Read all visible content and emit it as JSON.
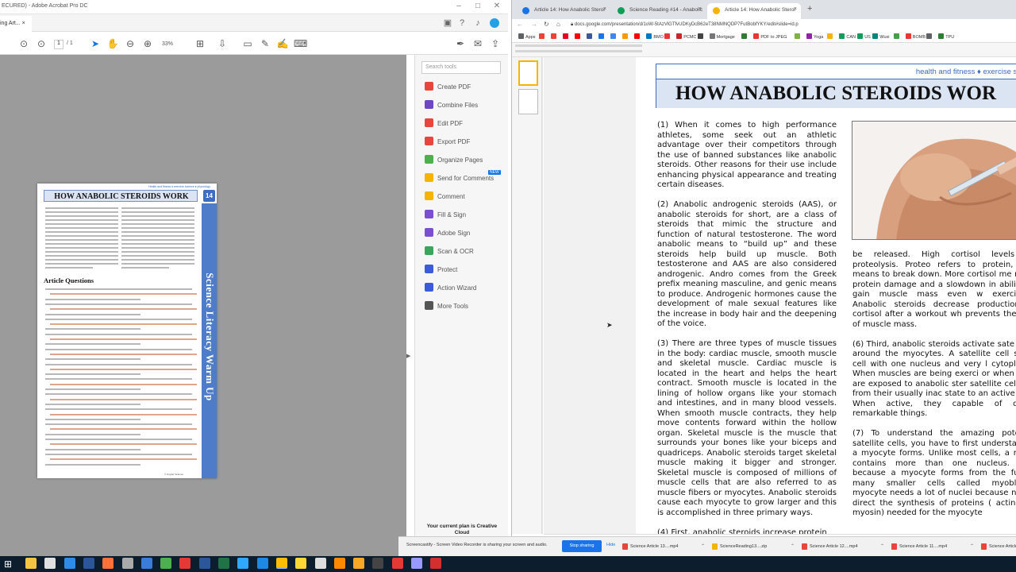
{
  "acrobat": {
    "title": "ECURED) - Adobe Acrobat Pro DC",
    "tab_label": "ing Art...",
    "page_current": "1",
    "page_total": "/ 1",
    "zoom": "33%",
    "tools_search_placeholder": "Search tools",
    "tools": [
      {
        "label": "Create PDF",
        "color": "#e8453c"
      },
      {
        "label": "Combine Files",
        "color": "#6f46c4"
      },
      {
        "label": "Edit PDF",
        "color": "#e8453c"
      },
      {
        "label": "Export PDF",
        "color": "#e8453c"
      },
      {
        "label": "Organize Pages",
        "color": "#4caf50"
      },
      {
        "label": "Send for Comments",
        "color": "#f4b400"
      },
      {
        "label": "Comment",
        "color": "#f4b400"
      },
      {
        "label": "Fill & Sign",
        "color": "#7b4fd1"
      },
      {
        "label": "Adobe Sign",
        "color": "#7b4fd1"
      },
      {
        "label": "Scan & OCR",
        "color": "#3ba55c"
      },
      {
        "label": "Protect",
        "color": "#3b5bdb"
      },
      {
        "label": "Action Wizard",
        "color": "#3b5bdb"
      },
      {
        "label": "More Tools",
        "color": "#555555"
      }
    ],
    "new_badge": "NEW",
    "plan_text": "Your current plan is Creative Cloud",
    "document": {
      "header_line": "Health and fitness ♦ exercise science ♦ physiology",
      "title": "HOW ANABOLIC STEROIDS WORK",
      "number": "14",
      "side_text": "Science Literacy Warm Up",
      "section_heading": "Article Questions",
      "credit": "© Snyder Science"
    }
  },
  "chrome": {
    "tabs": [
      {
        "label": "Article 14: How Anabolic Steroi",
        "color": "#1a73e8",
        "active": false
      },
      {
        "label": "Science Reading #14 - Anabolic",
        "color": "#0f9d58",
        "active": false
      },
      {
        "label": "Article 14: How Anabolic Steroi",
        "color": "#f4b400",
        "active": true
      }
    ],
    "new_tab": "+",
    "url": "docs.google.com/presentation/d/1oW-5tAzVlGTfvUDKyDcB62eT38NMNQDP7FutBobfYKY/edit#slide=id.p",
    "bookmarks": [
      {
        "label": "Apps",
        "color": "#5f6368"
      },
      {
        "label": "",
        "color": "#ea4335"
      },
      {
        "label": "",
        "color": "#ea4335"
      },
      {
        "label": "",
        "color": "#e60023"
      },
      {
        "label": "",
        "color": "#ff0000"
      },
      {
        "label": "",
        "color": "#3b5998"
      },
      {
        "label": "",
        "color": "#1a73e8"
      },
      {
        "label": "",
        "color": "#4285f4"
      },
      {
        "label": "",
        "color": "#ff9900"
      },
      {
        "label": "",
        "color": "#ff0000"
      },
      {
        "label": "BMO",
        "color": "#0079c1"
      },
      {
        "label": "",
        "color": "#e53935"
      },
      {
        "label": "PCMC",
        "color": "#c62828"
      },
      {
        "label": "",
        "color": "#444444"
      },
      {
        "label": "Mortgage",
        "color": "#777777"
      },
      {
        "label": "",
        "color": "#2e7d32"
      },
      {
        "label": "PDF to JPEG",
        "color": "#e53935"
      },
      {
        "label": "",
        "color": "#7cb342"
      },
      {
        "label": "Yoga",
        "color": "#8e24aa"
      },
      {
        "label": "",
        "color": "#f4b400"
      },
      {
        "label": "CAN",
        "color": "#0f9d58"
      },
      {
        "label": "US",
        "color": "#0f9d58"
      },
      {
        "label": "Wuxi",
        "color": "#00897b"
      },
      {
        "label": "",
        "color": "#43a047"
      },
      {
        "label": "BOMB",
        "color": "#e53935"
      },
      {
        "label": "",
        "color": "#5f6368"
      },
      {
        "label": "TPU",
        "color": "#2e7d32"
      }
    ],
    "slide": {
      "header": "health and fitness ♦ exercise sc",
      "title": "HOW ANABOLIC STEROIDS WOR",
      "col1": [
        "(1)   When it comes to high performance athletes, some seek out an athletic advantage over their competitors through the use of banned substances like anabolic steroids. Other reasons for their use include enhancing physical appearance and treating certain diseases.",
        "(2) Anabolic androgenic steroids (AAS), or anabolic steroids for short, are a class of steroids that mimic the structure and function of natural testosterone. The word anabolic means to “build up” and these steroids help build up muscle. Both testosterone and AAS are also considered androgenic. Andro comes from the Greek prefix meaning masculine, and genic means to produce. Androgenic hormones cause the development of male sexual features like the increase in body hair and the deepening of the voice.",
        "(3) There are three types of muscle tissues in the body: cardiac muscle, smooth muscle and skeletal muscle. Cardiac muscle is located in the heart and helps the heart contract. Smooth muscle is located in the lining of hollow organs like your stomach and intestines, and in many blood vessels. When smooth muscle contracts, they help move contents forward within the hollow organ. Skeletal muscle is the muscle that surrounds your bones like your biceps and quadriceps. Anabolic steroids target skeletal muscle making it bigger and stronger. Skeletal muscle is composed of millions of muscle cells that are also referred to as muscle fibers or myocytes. Anabolic steroids cause each myocyte to grow larger and this is accomplished in three primary ways.",
        "(4)   First, anabolic steroids increase protein"
      ],
      "col2": [
        "be released. High cortisol levels ca proteolysis. Proteo refers to protein, and means to break down. More cortisol me more protein damage and a slowdown in ability to gain muscle mass even w exercising. Anabolic steroids decrease production of cortisol after a workout wh prevents the loss of muscle mass.",
        "(6) Third, anabolic steroids activate sate cells around the myocytes. A satellite cell small cell with one nucleus and very l cytoplasm. When muscles are being exerci or when they are exposed to anabolic ster satellite cells go from their usually inac state to an active one. When active, they capable of doing remarkable things.",
        "(7) To understand the amazing potentia satellite cells, you have to first understand h a myocyte forms. Unlike most cells, a myoc contains more than one nucleus. This because a myocyte forms from the fusion many smaller cells called myoblasts. myocyte needs a lot of nuclei because nuclei direct the synthesis of proteins ( actin and myosin) needed for the myocyte"
      ]
    }
  },
  "share_bar": {
    "message": "Screencastify - Screen Video Recorder is sharing your screen and audio.",
    "stop": "Stop sharing",
    "hide": "Hide",
    "downloads": [
      {
        "label": "Science Article 13....mp4",
        "color": "#e8453c"
      },
      {
        "label": "ScienceReading13....zip",
        "color": "#f4b400"
      },
      {
        "label": "Science Article 12....mp4",
        "color": "#e8453c"
      },
      {
        "label": "Science Article 11....mp4",
        "color": "#e8453c"
      },
      {
        "label": "Science Article 1",
        "color": "#e8453c"
      }
    ]
  },
  "taskbar": {
    "apps": [
      {
        "name": "file-explorer-icon",
        "color": "#f4c542"
      },
      {
        "name": "calculator-icon",
        "color": "#e0e0e0"
      },
      {
        "name": "edge-icon",
        "color": "#2f8be6"
      },
      {
        "name": "word-icon",
        "color": "#2b579a"
      },
      {
        "name": "firefox-icon",
        "color": "#ff7139"
      },
      {
        "name": "app-icon",
        "color": "#aaaaaa"
      },
      {
        "name": "app-icon-2",
        "color": "#3b7bd9"
      },
      {
        "name": "chrome-icon",
        "color": "#4caf50"
      },
      {
        "name": "acrobat-red-icon",
        "color": "#e53935"
      },
      {
        "name": "word-icon-2",
        "color": "#2b579a"
      },
      {
        "name": "excel-icon",
        "color": "#217346"
      },
      {
        "name": "photoshop-icon",
        "color": "#31a8ff"
      },
      {
        "name": "app-icon-3",
        "color": "#1e88e5"
      },
      {
        "name": "chrome-active-icon",
        "color": "#fbbc05"
      },
      {
        "name": "sticky-notes-icon",
        "color": "#fdd835"
      },
      {
        "name": "app-icon-4",
        "color": "#dddddd"
      },
      {
        "name": "vlc-icon",
        "color": "#ff8800"
      },
      {
        "name": "app-icon-5",
        "color": "#f9a825"
      },
      {
        "name": "app-icon-6",
        "color": "#444444"
      },
      {
        "name": "screencast-icon",
        "color": "#e53935"
      },
      {
        "name": "premiere-icon",
        "color": "#9999ff"
      },
      {
        "name": "acrobat-icon",
        "color": "#d32f2f"
      }
    ]
  }
}
